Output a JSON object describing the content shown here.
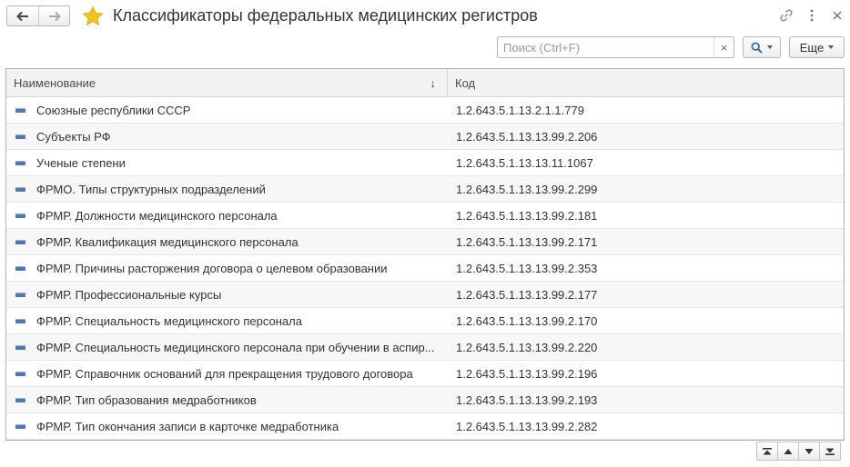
{
  "window": {
    "title": "Классификаторы федеральных медицинских регистров"
  },
  "search": {
    "placeholder": "Поиск (Ctrl+F)",
    "value": "",
    "clear_label": "×"
  },
  "toolbar": {
    "more_label": "Еще"
  },
  "table": {
    "columns": {
      "name": "Наименование",
      "code": "Код"
    },
    "sort_icon": "↓",
    "rows": [
      {
        "name": "Союзные республики СССР",
        "code": "1.2.643.5.1.13.2.1.1.779"
      },
      {
        "name": "Субъекты РФ",
        "code": "1.2.643.5.1.13.13.99.2.206"
      },
      {
        "name": "Ученые степени",
        "code": "1.2.643.5.1.13.13.11.1067"
      },
      {
        "name": "ФРМО. Типы структурных подразделений",
        "code": "1.2.643.5.1.13.13.99.2.299"
      },
      {
        "name": "ФРМР. Должности медицинского персонала",
        "code": "1.2.643.5.1.13.13.99.2.181"
      },
      {
        "name": "ФРМР. Квалификация медицинского персонала",
        "code": "1.2.643.5.1.13.13.99.2.171"
      },
      {
        "name": "ФРМР. Причины расторжения договора о целевом образовании",
        "code": "1.2.643.5.1.13.13.99.2.353"
      },
      {
        "name": "ФРМР. Профессиональные курсы",
        "code": "1.2.643.5.1.13.13.99.2.177"
      },
      {
        "name": "ФРМР. Специальность медицинского персонала",
        "code": "1.2.643.5.1.13.13.99.2.170"
      },
      {
        "name": "ФРМР. Специальность медицинского персонала при обучении в аспир...",
        "code": "1.2.643.5.1.13.13.99.2.220"
      },
      {
        "name": "ФРМР. Справочник оснований для прекращения трудового договора",
        "code": "1.2.643.5.1.13.13.99.2.196"
      },
      {
        "name": "ФРМР. Тип образования медработников",
        "code": "1.2.643.5.1.13.13.99.2.193"
      },
      {
        "name": "ФРМР. Тип окончания записи в карточке медработника",
        "code": "1.2.643.5.1.13.13.99.2.282"
      }
    ]
  },
  "icons": {
    "back": "arrow-left-icon",
    "forward": "arrow-right-icon",
    "favorite": "star-icon",
    "link": "link-icon",
    "menu": "more-vertical-icon",
    "close": "close-icon",
    "search": "search-icon",
    "row": "catalog-item-icon",
    "scroll_top": "scroll-top-icon",
    "scroll_up": "scroll-up-icon",
    "scroll_down": "scroll-down-icon",
    "scroll_bottom": "scroll-bottom-icon"
  },
  "colors": {
    "star": "#f3c319",
    "accent": "#4a78b8"
  }
}
